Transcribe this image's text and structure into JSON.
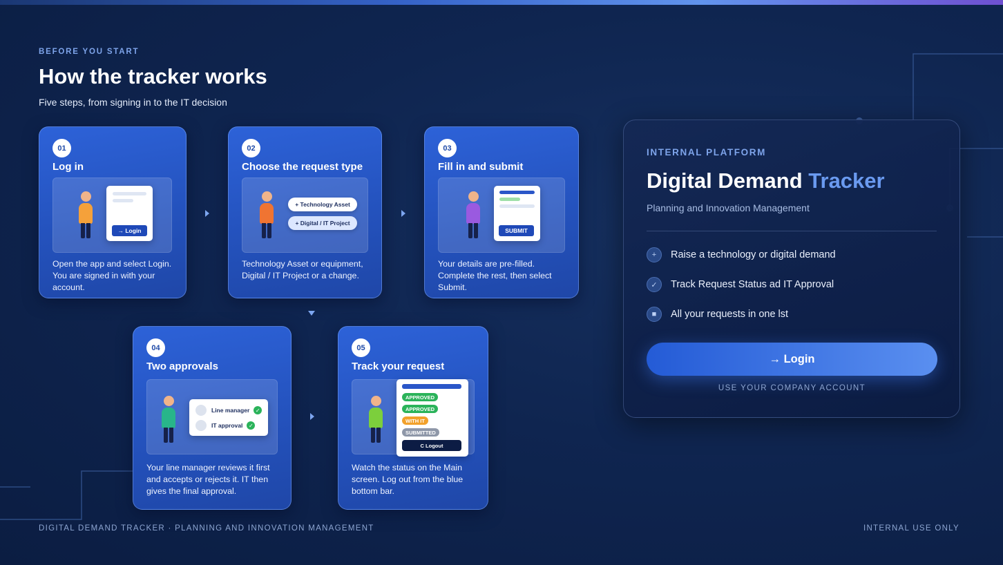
{
  "intro": {
    "eyebrow": "BEFORE YOU START",
    "heading": "How the tracker works",
    "subheading": "Five steps, from signing in to the IT decision"
  },
  "steps": [
    {
      "number": "01",
      "title": "Log in",
      "description": "Open the app and select Login. You are signed in with your account.",
      "illustration": {
        "button_label": "→ Login",
        "person_color": "#f5a13a"
      }
    },
    {
      "number": "02",
      "title": "Choose the request type",
      "description": "Technology Asset or equipment, Digital / IT Project or a change.",
      "illustration": {
        "options": [
          "+ Technology Asset",
          "+ Digital / IT Project"
        ],
        "person_color": "#f07432"
      }
    },
    {
      "number": "03",
      "title": "Fill in and submit",
      "description": "Your details are pre-filled. Complete the rest, then select Submit.",
      "illustration": {
        "button_label": "SUBMIT",
        "person_color": "#9a5ae0"
      }
    },
    {
      "number": "04",
      "title": "Two approvals",
      "description": "Your line manager reviews it first and accepts or rejects it. IT then gives the final approval.",
      "illustration": {
        "approvals": [
          "Line manager",
          "IT approval"
        ],
        "person_color": "#28b58a"
      }
    },
    {
      "number": "05",
      "title": "Track your request",
      "description": "Watch the status on the Main screen. Log out from the blue bottom bar.",
      "illustration": {
        "statuses": [
          {
            "label": "APPROVED",
            "color": "#2bb35a"
          },
          {
            "label": "APPROVED",
            "color": "#2bb35a"
          },
          {
            "label": "WITH IT",
            "color": "#f2a12b"
          },
          {
            "label": "SUBMITTED",
            "color": "#8e97a8"
          }
        ],
        "logout_label": "C Logout",
        "person_color": "#7ccf3c"
      }
    }
  ],
  "panel": {
    "eyebrow": "INTERNAL PLATFORM",
    "title_main": "Digital Demand",
    "title_accent": "Tracker",
    "subtitle": "Planning and Innovation Management",
    "features": [
      {
        "icon": "plus-icon",
        "glyph": "+",
        "label": "Raise a technology or digital demand"
      },
      {
        "icon": "check-icon",
        "glyph": "✓",
        "label": "Track Request Status ad IT Approval"
      },
      {
        "icon": "list-icon",
        "glyph": "■",
        "label": "All your requests in one lst"
      }
    ],
    "login_label": "→ Login",
    "login_note": "USE YOUR COMPANY ACCOUNT"
  },
  "footer": {
    "left": "DIGITAL DEMAND TRACKER · PLANNING AND INNOVATION MANAGEMENT",
    "right": "INTERNAL USE ONLY"
  },
  "colors": {
    "accent": "#6a9af0",
    "card_blue": "#2d62d8",
    "background": "#0f2550"
  }
}
